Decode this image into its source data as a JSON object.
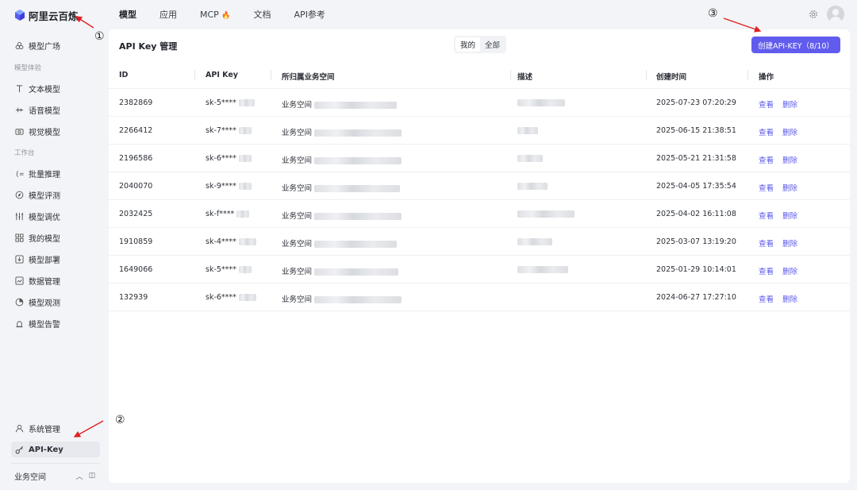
{
  "brand": {
    "name": "阿里云百炼"
  },
  "sidebar": {
    "items_top": [
      {
        "label": "模型广场",
        "icon": "model-square-icon"
      }
    ],
    "group_experience": "模型体验",
    "experience_items": [
      {
        "label": "文本模型",
        "icon": "text-icon"
      },
      {
        "label": "语音模型",
        "icon": "audio-icon"
      },
      {
        "label": "视觉模型",
        "icon": "camera-icon"
      }
    ],
    "group_workbench": "工作台",
    "workbench_items": [
      {
        "label": "批量推理",
        "icon": "batch-icon"
      },
      {
        "label": "模型评测",
        "icon": "evaluate-icon"
      },
      {
        "label": "模型调优",
        "icon": "tuning-icon"
      },
      {
        "label": "我的模型",
        "icon": "grid-icon"
      },
      {
        "label": "模型部署",
        "icon": "deploy-icon"
      },
      {
        "label": "数据管理",
        "icon": "chart-icon"
      },
      {
        "label": "模型观测",
        "icon": "observe-icon"
      },
      {
        "label": "模型告警",
        "icon": "alarm-icon"
      }
    ],
    "bottom_items": [
      {
        "label": "系统管理",
        "icon": "user-icon"
      },
      {
        "label": "API-Key",
        "icon": "key-icon"
      }
    ],
    "workspace": "业务空间"
  },
  "topnav": {
    "tabs": [
      "模型",
      "应用",
      "MCP",
      "文档",
      "API参考"
    ],
    "mcp_badge": "🔥"
  },
  "panel": {
    "title": "API Key 管理",
    "seg_options": [
      "我的",
      "全部"
    ],
    "create_label": "创建API-KEY（8/10）"
  },
  "table": {
    "headers": [
      "ID",
      "API Key",
      "所归属业务空间",
      "描述",
      "创建时间",
      "操作"
    ],
    "rows": [
      {
        "id": "2382869",
        "key": "sk-5****",
        "space": "业务空间",
        "time": "2025-07-23 07:20:29"
      },
      {
        "id": "2266412",
        "key": "sk-7****",
        "space": "业务空间",
        "time": "2025-06-15 21:38:51"
      },
      {
        "id": "2196586",
        "key": "sk-6****",
        "space": "业务空间",
        "time": "2025-05-21 21:31:58"
      },
      {
        "id": "2040070",
        "key": "sk-9****",
        "space": "业务空间",
        "time": "2025-04-05 17:35:54"
      },
      {
        "id": "2032425",
        "key": "sk-f****",
        "space": "业务空间",
        "time": "2025-04-02 16:11:08"
      },
      {
        "id": "1910859",
        "key": "sk-4****",
        "space": "业务空间",
        "time": "2025-03-07 13:19:20"
      },
      {
        "id": "1649066",
        "key": "sk-5****",
        "space": "业务空间",
        "time": "2025-01-29 10:14:01"
      },
      {
        "id": "132939",
        "key": "sk-6****",
        "space": "业务空间",
        "time": "2024-06-27 17:27:10"
      }
    ],
    "op_view": "查看",
    "op_delete": "删除"
  },
  "annotations": [
    "①",
    "②",
    "③"
  ],
  "colors": {
    "accent": "#615ced",
    "link": "#5b58e8",
    "annotation_arrow": "#e02020"
  }
}
